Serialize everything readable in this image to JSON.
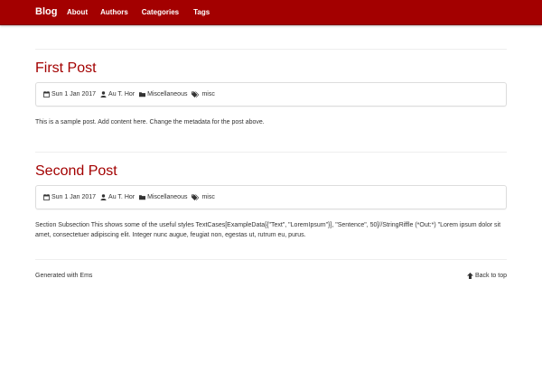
{
  "nav": {
    "brand": "Blog",
    "links": [
      "About",
      "Authors",
      "Categories",
      "Tags"
    ]
  },
  "posts": [
    {
      "title": "First Post",
      "date": "Sun 1 Jan 2017",
      "author": "Au T. Hor",
      "category": "Miscellaneous",
      "tag": "misc",
      "body": "This is a sample post. Add content here. Change the metadata for the post above."
    },
    {
      "title": "Second Post",
      "date": "Sun 1 Jan 2017",
      "author": "Au T. Hor",
      "category": "Miscellaneous",
      "tag": "misc",
      "body": " Section Subsection This shows some of the useful styles TextCases[ExampleData[{\"Text\", \"LoremIpsum\"}], \"Sentence\", 50]//StringRiffle (*Out:*) \"Lorem ipsum dolor sit amet, consectetuer adipiscing elit. Integer nunc augue, feugiat non, egestas ut, rutrum eu, purus."
    }
  ],
  "footer": {
    "generated": "Generated with Ems",
    "back_to_top": "Back to top"
  },
  "colors": {
    "brand_red": "#a30000",
    "title_red": "#a30000"
  },
  "icons": {
    "date": "calendar-icon",
    "author": "user-icon",
    "category": "folder-icon",
    "tag": "tags-icon",
    "back_to_top": "arrow-up-icon"
  }
}
